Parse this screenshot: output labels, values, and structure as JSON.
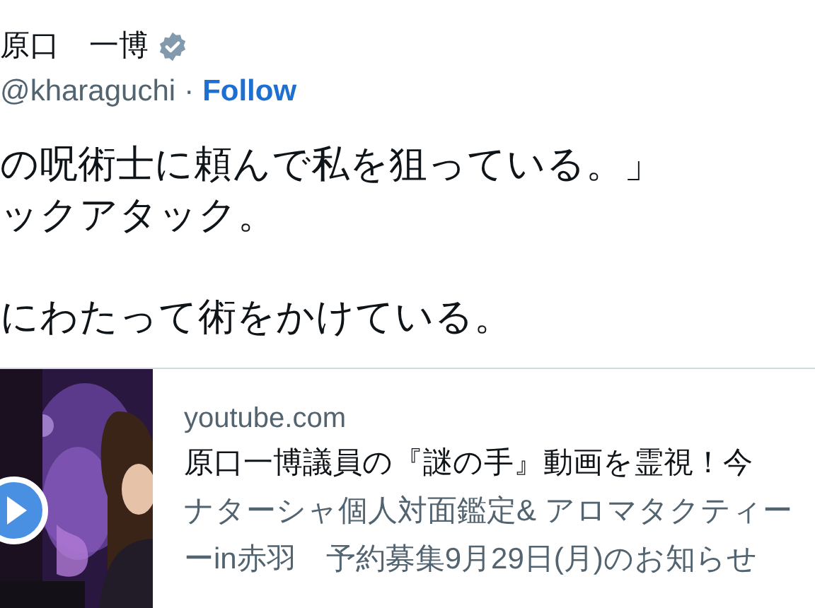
{
  "author": {
    "name": "原口　一博",
    "verified": true,
    "handle": "@kharaguchi",
    "separator": "·",
    "follow": "Follow"
  },
  "paragraphs": [
    [
      "の呪術士に頼んで私を狙っている。」",
      "ックアタック。"
    ],
    [
      "にわたって術をかけている。"
    ]
  ],
  "link_card": {
    "domain": "youtube.com",
    "title": "原口一博議員の『謎の手』動画を霊視！今",
    "description_lines": [
      "ナターシャ個人対面鑑定& アロマタクティー",
      "ーin赤羽　予約募集9月29日(月)のお知らせ"
    ]
  }
}
